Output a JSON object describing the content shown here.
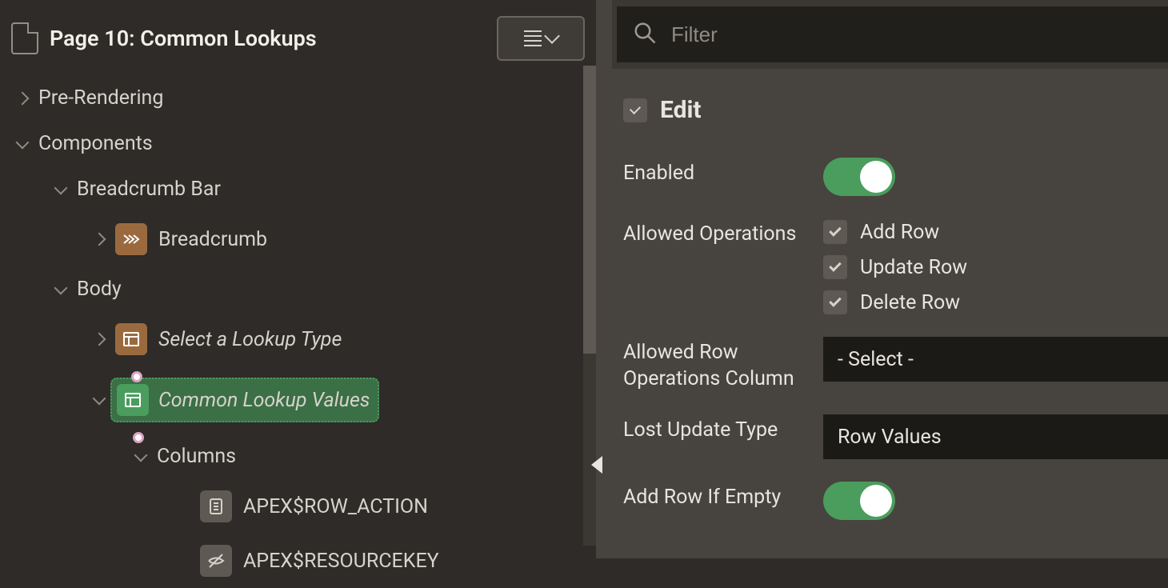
{
  "page": {
    "title": "Page 10: Common Lookups"
  },
  "tree": {
    "pre_rendering": "Pre-Rendering",
    "components": "Components",
    "breadcrumb_bar": "Breadcrumb Bar",
    "breadcrumb": "Breadcrumb",
    "body": "Body",
    "select_lookup": "Select a Lookup Type",
    "common_lookup": "Common Lookup Values",
    "columns": "Columns",
    "col1": "APEX$ROW_ACTION",
    "col2": "APEX$RESOURCEKEY"
  },
  "filter": {
    "placeholder": "Filter"
  },
  "section": {
    "title": "Edit"
  },
  "props": {
    "enabled_label": "Enabled",
    "allowed_ops_label": "Allowed Operations",
    "op_add": "Add Row",
    "op_update": "Update Row",
    "op_delete": "Delete Row",
    "allowed_col_label": "Allowed Row Operations Column",
    "allowed_col_value": "- Select -",
    "lost_update_label": "Lost Update Type",
    "lost_update_value": "Row Values",
    "add_row_empty_label": "Add Row If Empty"
  }
}
